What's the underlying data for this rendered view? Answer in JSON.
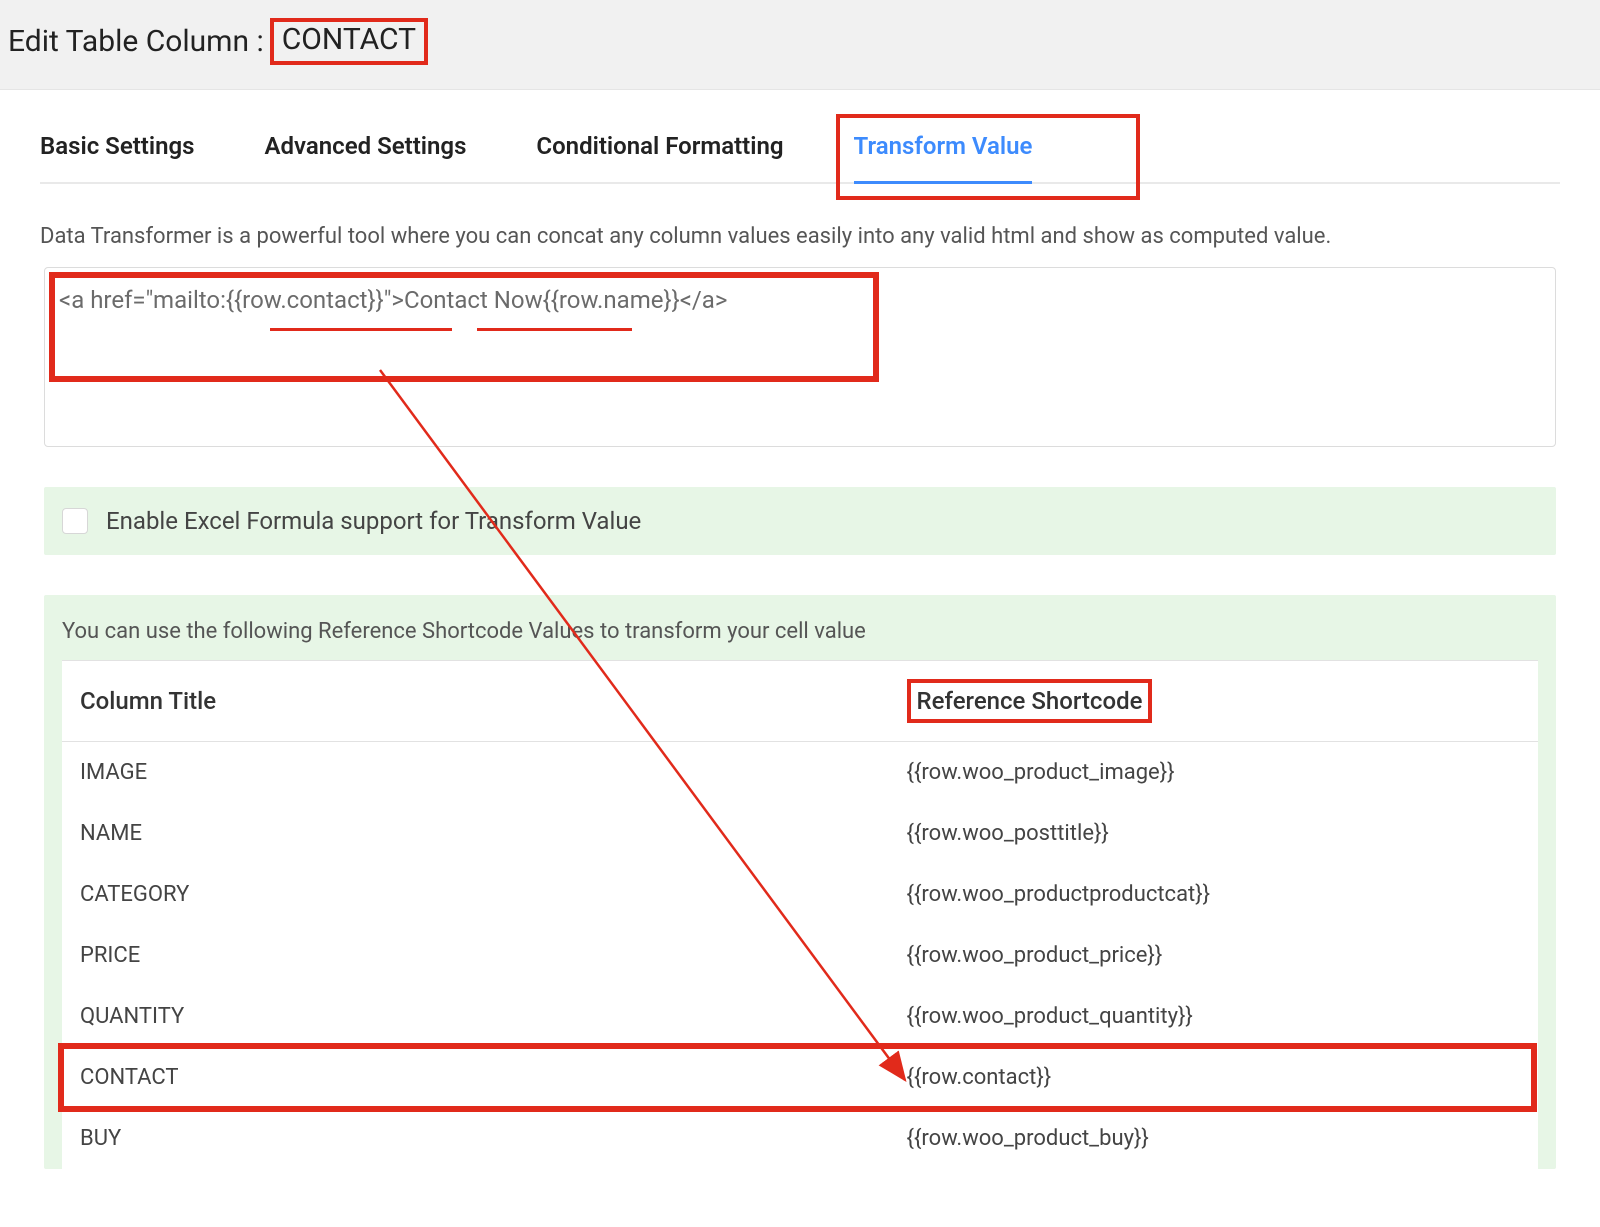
{
  "header": {
    "prefix": "Edit Table Column :",
    "column_name": "CONTACT"
  },
  "tabs": [
    {
      "label": "Basic Settings",
      "active": false
    },
    {
      "label": "Advanced Settings",
      "active": false
    },
    {
      "label": "Conditional Formatting",
      "active": false
    },
    {
      "label": "Transform Value",
      "active": true
    }
  ],
  "description": "Data Transformer is a powerful tool where you can concat any column values easily into any valid html and show as computed value.",
  "transform_value": "<a href=\"mailto:{{row.contact}}\">Contact Now{{row.name}}</a>",
  "checkbox": {
    "label": "Enable Excel Formula support for Transform Value",
    "checked": false
  },
  "shortcode_panel": {
    "intro": "You can use the following Reference Shortcode Values to transform your cell value",
    "headers": {
      "col1": "Column Title",
      "col2": "Reference Shortcode"
    },
    "rows": [
      {
        "title": "IMAGE",
        "code": "{{row.woo_product_image}}",
        "highlight": false
      },
      {
        "title": "NAME",
        "code": "{{row.woo_posttitle}}",
        "highlight": false
      },
      {
        "title": "CATEGORY",
        "code": "{{row.woo_productproductcat}}",
        "highlight": false
      },
      {
        "title": "PRICE",
        "code": "{{row.woo_product_price}}",
        "highlight": false
      },
      {
        "title": "QUANTITY",
        "code": "{{row.woo_product_quantity}}",
        "highlight": false
      },
      {
        "title": "CONTACT",
        "code": "{{row.contact}}",
        "highlight": true
      },
      {
        "title": "BUY",
        "code": "{{row.woo_product_buy}}",
        "highlight": false
      }
    ]
  },
  "annotations": {
    "colors": {
      "highlight": "#e12a1b",
      "active_tab": "#3d8bfd",
      "panel_bg": "#e7f6e6"
    }
  }
}
